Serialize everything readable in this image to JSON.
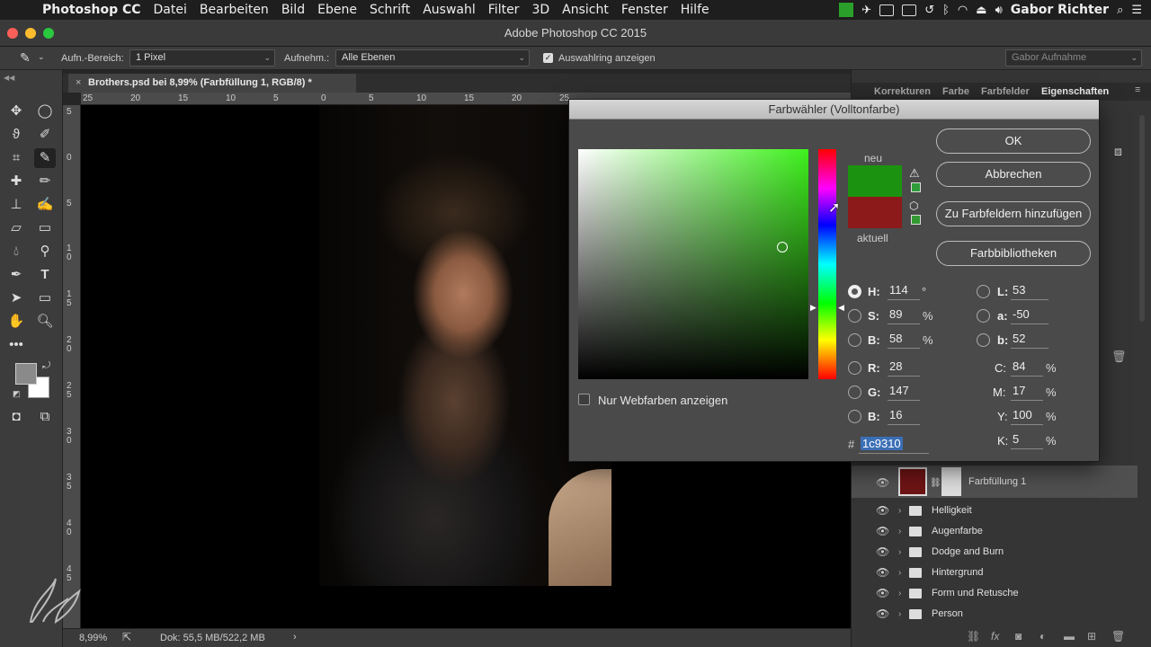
{
  "menubar": {
    "items": [
      "Photoshop CC",
      "Datei",
      "Bearbeiten",
      "Bild",
      "Ebene",
      "Schrift",
      "Auswahl",
      "Filter",
      "3D",
      "Ansicht",
      "Fenster",
      "Hilfe"
    ],
    "user": "Gabor Richter"
  },
  "window": {
    "title": "Adobe Photoshop CC 2015"
  },
  "options": {
    "sample_size_label": "Aufn.-Bereich:",
    "sample_size_value": "1 Pixel",
    "sample_label": "Aufnehm.:",
    "sample_value": "Alle Ebenen",
    "show_ring_label": "Auswahlring anzeigen",
    "workspace": "Gabor Aufnahme"
  },
  "document": {
    "tab_title": "Brothers.psd bei 8,99% (Farbfüllung 1, RGB/8) *",
    "ruler_h": [
      "25",
      "20",
      "15",
      "10",
      "5",
      "0",
      "5",
      "10",
      "15",
      "20",
      "25"
    ],
    "ruler_v": [
      "5",
      "0",
      "5",
      "1 0",
      "1 5",
      "2 0",
      "2 5",
      "3 0",
      "3 5",
      "4 0",
      "4 5"
    ]
  },
  "status": {
    "zoom": "8,99%",
    "doc": "Dok: 55,5 MB/522,2 MB"
  },
  "panels": {
    "tabs": [
      "Korrekturen",
      "Farbe",
      "Farbfelder",
      "Eigenschaften"
    ],
    "fill_layer": "Farbfüllung 1",
    "layers": [
      "Helligkeit",
      "Augenfarbe",
      "Dodge and Burn",
      "Hintergrund",
      "Form und Retusche",
      "Person"
    ]
  },
  "dialog": {
    "title": "Farbwähler (Volltonfarbe)",
    "new_label": "neu",
    "current_label": "aktuell",
    "buttons": [
      "OK",
      "Abbrechen",
      "Zu Farbfeldern hinzufügen",
      "Farbbibliotheken"
    ],
    "web_only_label": "Nur Webfarben anzeigen",
    "hsb": {
      "h": "114",
      "s": "89",
      "b": "58"
    },
    "rgb": {
      "r": "28",
      "g": "147",
      "b": "16"
    },
    "lab": {
      "l": "53",
      "a": "-50",
      "b": "52"
    },
    "cmyk": {
      "c": "84",
      "m": "17",
      "y": "100",
      "k": "5"
    },
    "hex_prefix": "#",
    "hex": "1c9310",
    "labels": {
      "h": "H:",
      "s": "S:",
      "b": "B:",
      "r": "R:",
      "g": "G:",
      "b2": "B:",
      "l": "L:",
      "a": "a:",
      "lb": "b:",
      "c": "C:",
      "m": "M:",
      "y": "Y:",
      "k": "K:"
    },
    "units": {
      "deg": "°",
      "pct": "%"
    },
    "colors": {
      "new": "#1c9310",
      "current": "#8c1a1a"
    }
  }
}
